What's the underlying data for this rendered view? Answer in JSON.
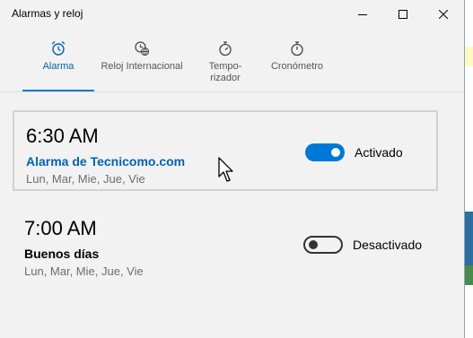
{
  "window": {
    "title": "Alarmas y reloj",
    "controls": [
      "minimize-icon",
      "maximize-icon",
      "close-icon"
    ]
  },
  "tabs": [
    {
      "label": "Alarma",
      "icon": "alarm-clock-icon",
      "active": true
    },
    {
      "label": "Reloj Internacional",
      "icon": "world-clock-icon",
      "active": false
    },
    {
      "label": "Tempo-\nrizador",
      "icon": "timer-icon",
      "active": false
    },
    {
      "label": "Cronómetro",
      "icon": "stopwatch-icon",
      "active": false
    }
  ],
  "alarms": [
    {
      "time": "6:30 AM",
      "name": "Alarma de Tecnicomo.com",
      "days": "Lun, Mar, Mie, Jue, Vie",
      "enabled": true,
      "state_label": "Activado"
    },
    {
      "time": "7:00 AM",
      "name": "Buenos días",
      "days": "Lun, Mar, Mie, Jue, Vie",
      "enabled": false,
      "state_label": "Desactivado"
    }
  ],
  "colors": {
    "accent": "#0078d7",
    "accent_text": "#0063b1",
    "background": "#f2f2f2"
  }
}
